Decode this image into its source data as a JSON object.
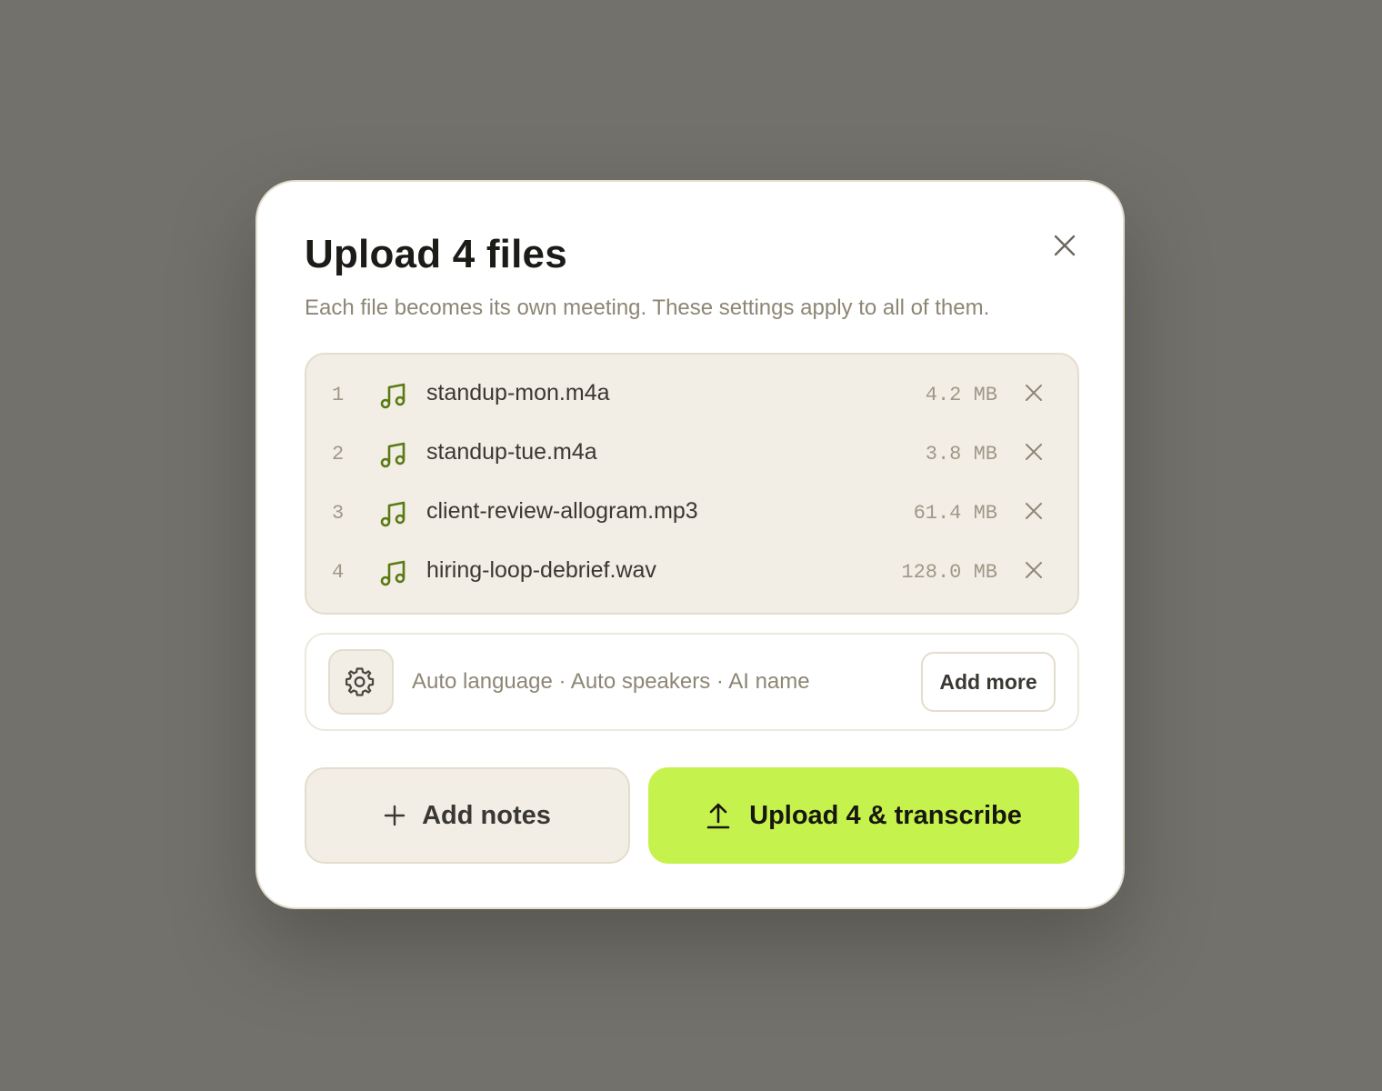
{
  "dialog": {
    "title": "Upload 4 files",
    "subtitle": "Each file becomes its own meeting. These settings apply to all of them."
  },
  "files": [
    {
      "index": "1",
      "name": "standup-mon.m4a",
      "size": "4.2 MB",
      "icon": "music-note-icon"
    },
    {
      "index": "2",
      "name": "standup-tue.m4a",
      "size": "3.8 MB",
      "icon": "music-note-icon"
    },
    {
      "index": "3",
      "name": "client-review-allogram.mp3",
      "size": "61.4 MB",
      "icon": "music-note-icon"
    },
    {
      "index": "4",
      "name": "hiring-loop-debrief.wav",
      "size": "128.0 MB",
      "icon": "music-note-icon"
    }
  ],
  "settings": {
    "summary": "Auto language · Auto speakers · AI name",
    "add_more_label": "Add more",
    "icon": "gear-icon"
  },
  "actions": {
    "add_notes_label": "Add notes",
    "upload_label": "Upload 4 & transcribe"
  },
  "colors": {
    "backdrop": "#72716c",
    "accent": "#c6f24e",
    "icon_green": "#5a7a12",
    "panel": "#f2eee6"
  }
}
